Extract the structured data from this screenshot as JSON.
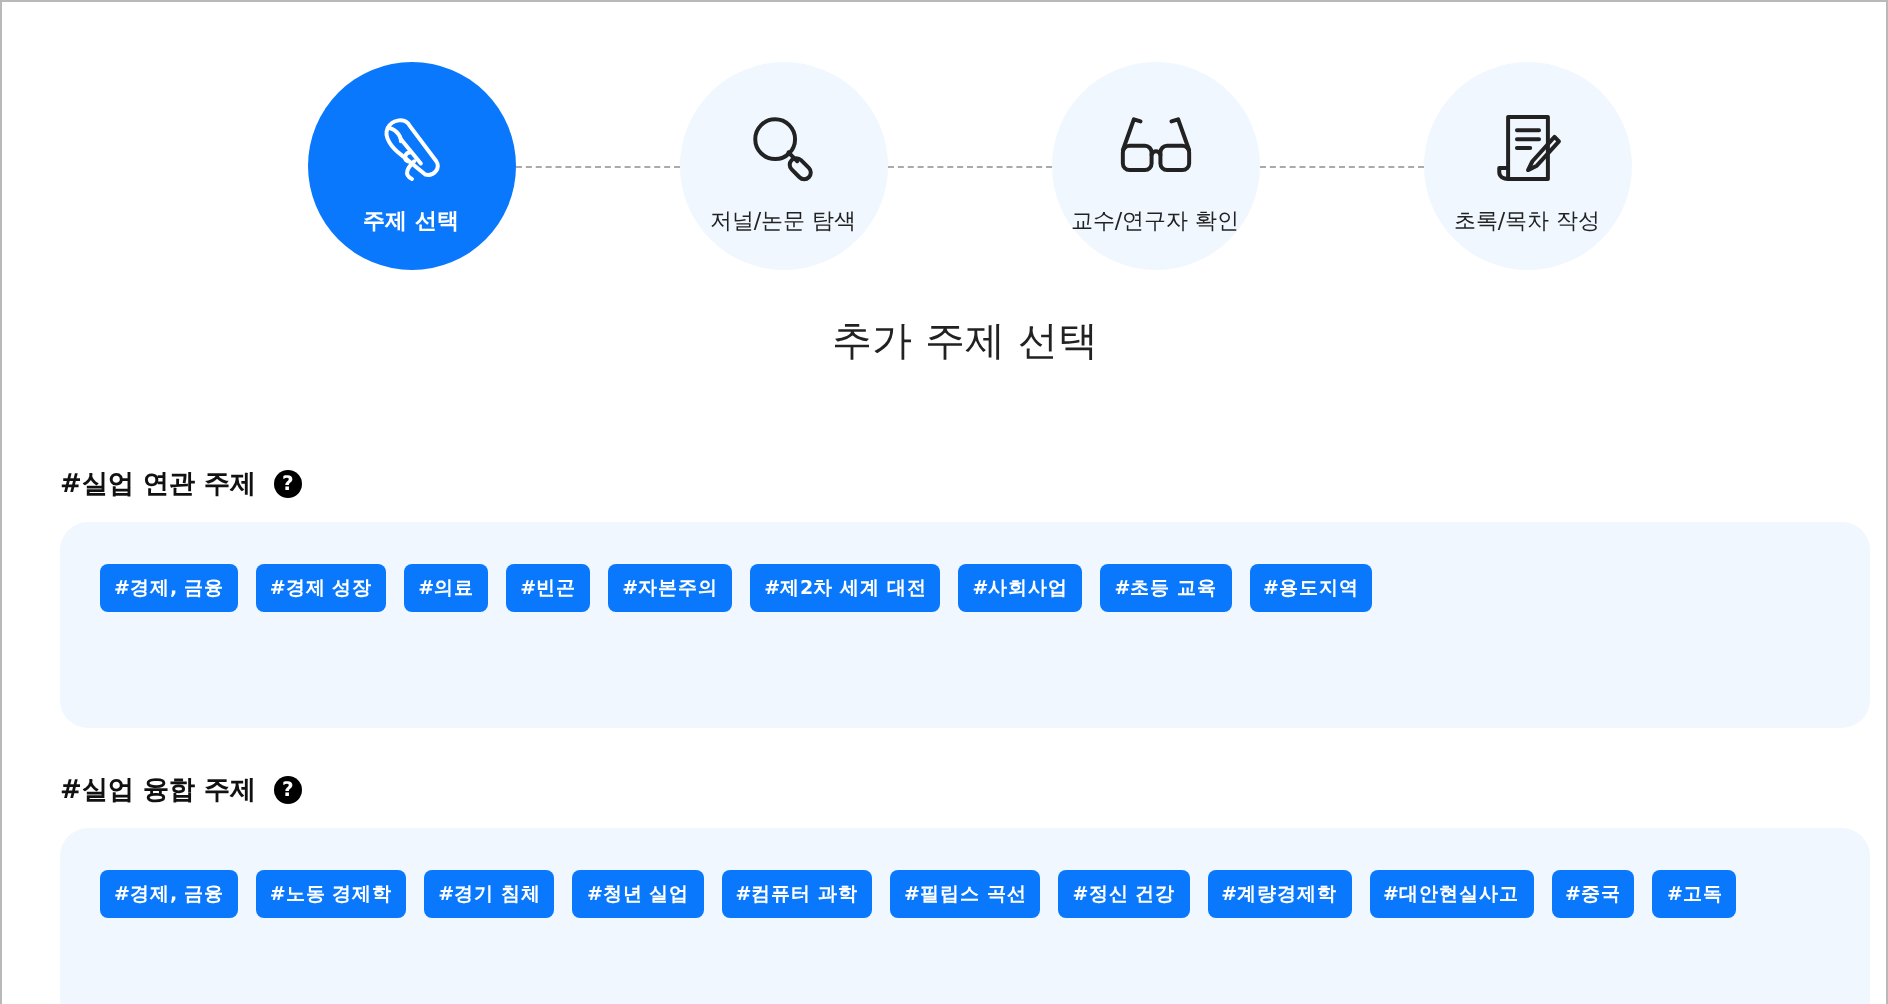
{
  "steps": [
    {
      "label": "주제 선택",
      "kind": "scroll",
      "selected": true
    },
    {
      "label": "저널/논문 탐색",
      "kind": "search",
      "selected": false
    },
    {
      "label": "교수/연구자 확인",
      "kind": "glasses",
      "selected": false
    },
    {
      "label": "초록/목차 작성",
      "kind": "write",
      "selected": false
    }
  ],
  "title": "추가 주제 선택",
  "sections": [
    {
      "heading": "#실업 연관 주제",
      "help": "?",
      "tags": [
        "#경제, 금융",
        "#경제 성장",
        "#의료",
        "#빈곤",
        "#자본주의",
        "#제2차 세계 대전",
        "#사회사업",
        "#초등 교육",
        "#용도지역"
      ]
    },
    {
      "heading": "#실업 융합 주제",
      "help": "?",
      "tags": [
        "#경제, 금융",
        "#노동 경제학",
        "#경기 침체",
        "#청년 실업",
        "#컴퓨터 과학",
        "#필립스 곡선",
        "#정신 건강",
        "#계량경제학",
        "#대안현실사고",
        "#중국",
        "#고독"
      ]
    }
  ]
}
